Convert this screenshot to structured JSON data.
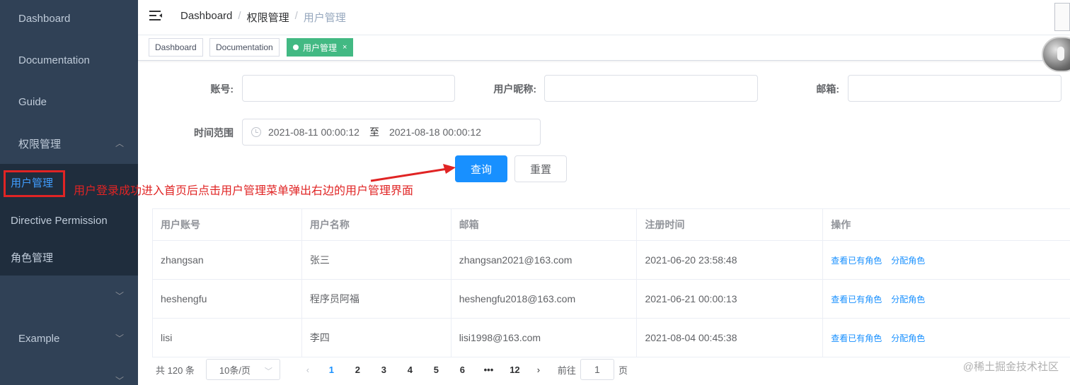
{
  "sidebar": {
    "items": [
      {
        "label": "Dashboard"
      },
      {
        "label": "Documentation"
      },
      {
        "label": "Guide"
      },
      {
        "label": "权限管理"
      },
      {
        "label": "Example"
      }
    ],
    "submenu": [
      {
        "label": "用户管理",
        "active": true
      },
      {
        "label": "Directive Permission"
      },
      {
        "label": "角色管理"
      }
    ]
  },
  "header": {
    "breadcrumb": [
      "Dashboard",
      "权限管理",
      "用户管理"
    ]
  },
  "tags": [
    {
      "label": "Dashboard"
    },
    {
      "label": "Documentation"
    },
    {
      "label": "用户管理",
      "active": true,
      "close": "×"
    }
  ],
  "form": {
    "account_label": "账号:",
    "account_value": "",
    "nickname_label": "用户昵称:",
    "nickname_value": "",
    "email_label": "邮箱:",
    "email_value": "",
    "time_label": "时间范围",
    "start_time": "2021-08-11 00:00:12",
    "range_sep": "至",
    "end_time": "2021-08-18 00:00:12",
    "search_btn": "查询",
    "reset_btn": "重置"
  },
  "annotation": "用户登录成功进入首页后点击用户管理菜单弹出右边的用户管理界面",
  "table": {
    "headers": [
      "用户账号",
      "用户名称",
      "邮箱",
      "注册时间",
      "操作"
    ],
    "rows": [
      {
        "account": "zhangsan",
        "name": "张三",
        "email": "zhangsan2021@163.com",
        "time": "2021-06-20 23:58:48"
      },
      {
        "account": "heshengfu",
        "name": "程序员阿福",
        "email": "heshengfu2018@163.com",
        "time": "2021-06-21 00:00:13"
      },
      {
        "account": "lisi",
        "name": "李四",
        "email": "lisi1998@163.com",
        "time": "2021-08-04 00:45:38"
      }
    ],
    "op_view": "查看已有角色",
    "op_assign": "分配角色"
  },
  "pagination": {
    "total": "共 120 条",
    "page_size": "10条/页",
    "pages": [
      "1",
      "2",
      "3",
      "4",
      "5",
      "6",
      "•••",
      "12"
    ],
    "current": "1",
    "goto": "前往",
    "goto_value": "1",
    "page_unit": "页"
  },
  "watermark": "@稀土掘金技术社区",
  "colors": {
    "sidebar": "#304156",
    "primary": "#1890ff",
    "active_tag": "#42b983",
    "annotation": "#e02424"
  }
}
